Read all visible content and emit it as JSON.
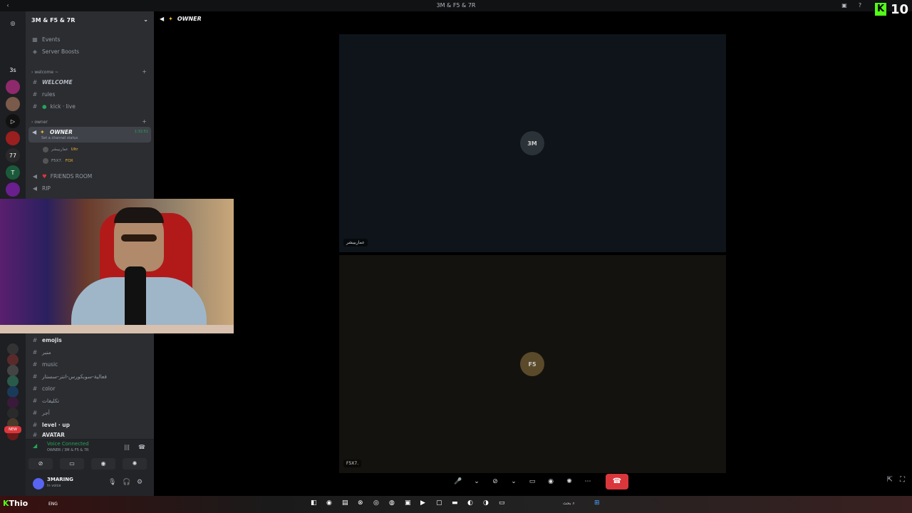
{
  "window": {
    "title": "3M & F5 & 7R"
  },
  "overlay": {
    "kick_letter": "K",
    "kick_count": "10"
  },
  "guilds": [
    {
      "label": "",
      "color": "#5865f2"
    },
    {
      "label": "3s",
      "color": "#1e1f22"
    },
    {
      "label": "",
      "color": "#8e2a6b"
    },
    {
      "label": "",
      "color": "#7a5a4a"
    },
    {
      "label": "▷",
      "color": "#111"
    },
    {
      "label": "",
      "color": "#9a1f1f"
    },
    {
      "label": "77",
      "color": "#2a2a2a"
    },
    {
      "label": "T",
      "color": "#1a5a3a"
    },
    {
      "label": "",
      "color": "#6a1f8e"
    },
    {
      "label": "",
      "color": "#333"
    }
  ],
  "sidebar": {
    "server_name": "3M & F5 & 7R",
    "events": "Events",
    "boosts": "Server Boosts",
    "cat_welcome": "welcome",
    "ch_welcome": "WELCOME",
    "ch_rules": "rules",
    "ch_kick": "kick · live",
    "cat_owner": "owner",
    "active_channel": {
      "name": "OWNER",
      "status": "Set a channel status",
      "time": "1:32:51"
    },
    "members": [
      {
        "name": "عماربيبشر",
        "tag": "Ultr"
      },
      {
        "name": "F5X7.",
        "tag": "FOX"
      }
    ],
    "ch_friends": "FRIENDS ROOM",
    "ch_rip": "RIP",
    "ch_emojis": "emojis",
    "ch_minbar": "منبر",
    "ch_music": "music",
    "ch_long": "فعالية-سوبكورس-انتر-سستار",
    "ch_color": "color",
    "ch_takleefat": "تكليفات",
    "ch_ajr": "أجر",
    "ch_level": "level · up",
    "ch_avatar": "AVATAR",
    "new_badge": "NEW"
  },
  "voice": {
    "connected": "Voice Connected",
    "location": "OWNER / 3M & F5 & 7R"
  },
  "user": {
    "name": "3MARING",
    "status": "In voice"
  },
  "main": {
    "channel_title": "OWNER",
    "tile1": {
      "initials": "3M",
      "name": "عماربيبشر"
    },
    "tile2": {
      "initials": "F5",
      "name": "F5X7."
    }
  },
  "taskbar": {
    "kick_label": "Thio",
    "lang": "ENG",
    "search": "بحث"
  }
}
